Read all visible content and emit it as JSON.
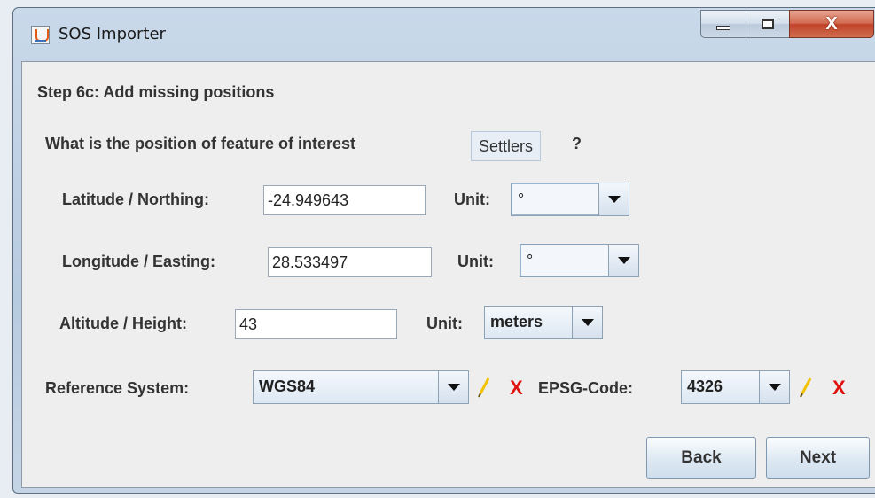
{
  "window": {
    "title": "SOS Importer",
    "close_glyph": "X"
  },
  "step": {
    "heading": "Step 6c: Add missing positions"
  },
  "question": {
    "prefix": "What is the position of feature of interest",
    "feature": "Settlers",
    "suffix": "?"
  },
  "latitude": {
    "label": "Latitude / Northing:",
    "value": "-24.949643",
    "unit_label": "Unit:",
    "unit": "°"
  },
  "longitude": {
    "label": "Longitude / Easting:",
    "value": "28.533497",
    "unit_label": "Unit:",
    "unit": "°"
  },
  "altitude": {
    "label": "Altitude / Height:",
    "value": "43",
    "unit_label": "Unit:",
    "unit": "meters"
  },
  "reference": {
    "label": "Reference System:",
    "system": "WGS84",
    "epsg_label": "EPSG-Code:",
    "epsg": "4326",
    "delete_glyph": "X"
  },
  "buttons": {
    "back": "Back",
    "next": "Next"
  },
  "colors": {
    "delete": "#e0120f",
    "edit": "#f2c200"
  },
  "icons": [
    "java-app-icon",
    "minimize-icon",
    "maximize-icon",
    "close-icon",
    "dropdown-arrow-icon",
    "pencil-icon",
    "delete-icon"
  ]
}
